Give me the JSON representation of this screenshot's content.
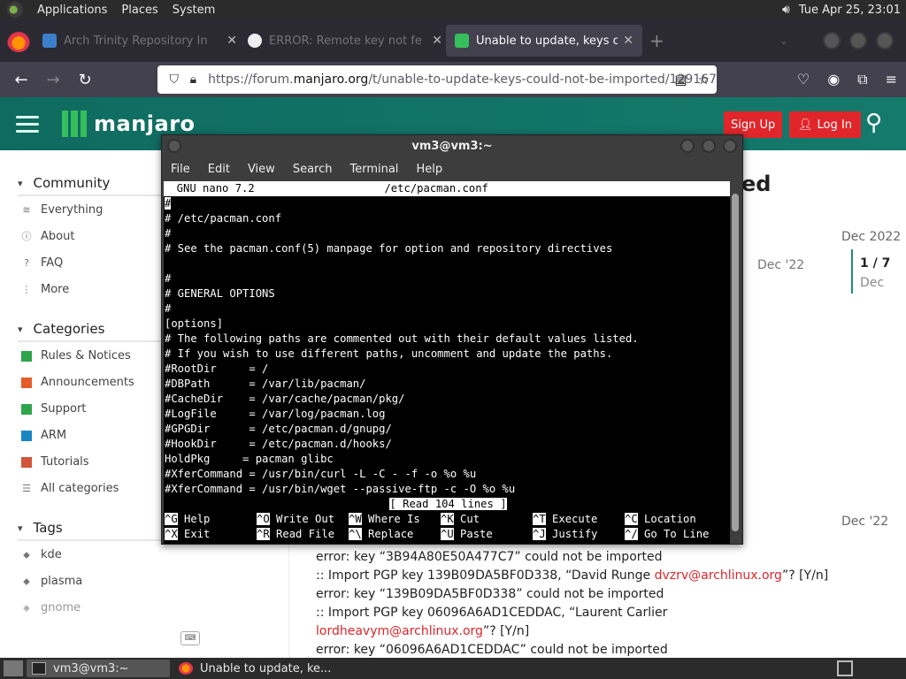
{
  "system_panel": {
    "menus": [
      "Applications",
      "Places",
      "System"
    ],
    "clock": "Tue Apr 25, 23:01"
  },
  "tabs": [
    {
      "title": "Arch Trinity Repository In",
      "active": false
    },
    {
      "title": "ERROR: Remote key not fe",
      "active": false
    },
    {
      "title": "Unable to update, keys could",
      "active": true
    }
  ],
  "urlbar": {
    "prefix": "https://forum.",
    "domain": "manjaro.org",
    "path": "/t/unable-to-update-keys-could-not-be-imported/129167"
  },
  "site": {
    "logo": "manjaro",
    "signup": "Sign Up",
    "login": "Log In",
    "title_fragment": "ed"
  },
  "sidebar": {
    "community": {
      "heading": "Community",
      "items": [
        "Everything",
        "About",
        "FAQ",
        "More"
      ]
    },
    "categories": {
      "heading": "Categories",
      "items": [
        {
          "label": "Rules & Notices",
          "color": "#2da54a"
        },
        {
          "label": "Announcements",
          "color": "#e45d28"
        },
        {
          "label": "Support",
          "color": "#2da54a"
        },
        {
          "label": "ARM",
          "color": "#1a86c1"
        },
        {
          "label": "Tutorials",
          "color": "#d2543b"
        },
        {
          "label": "All categories",
          "color": ""
        }
      ]
    },
    "tags": {
      "heading": "Tags",
      "items": [
        "kde",
        "plasma",
        "gnome"
      ]
    }
  },
  "timeline": {
    "date_top": "Dec 2022",
    "post_date": "Dec '22",
    "progress": "1 / 7",
    "progress_sub": "Dec",
    "post_date_2": "Dec '22"
  },
  "post_lines": {
    "l1": "error: key “3B94A80E50A477C7” could not be imported",
    "l2_a": ":: Import PGP key 139B09DA5BF0D338, “David Runge ",
    "l2_mail": "dvzrv@archlinux.org",
    "l2_b": "”? [Y/n]",
    "l3": "error: key “139B09DA5BF0D338” could not be imported",
    "l4": ":: Import PGP key 06096A6AD1CEDDAC, “Laurent Carlier",
    "l5_mail": "lordheavym@archlinux.org",
    "l5_b": "”? [Y/n]",
    "l6": "error: key “06096A6AD1CEDDAC” could not be imported"
  },
  "terminal": {
    "title": "vm3@vm3:~",
    "menu": [
      "File",
      "Edit",
      "View",
      "Search",
      "Terminal",
      "Help"
    ],
    "nano_header": "  GNU nano 7.2                    /etc/pacman.conf",
    "lines": [
      "#",
      "# /etc/pacman.conf",
      "#",
      "# See the pacman.conf(5) manpage for option and repository directives",
      "",
      "#",
      "# GENERAL OPTIONS",
      "#",
      "[options]",
      "# The following paths are commented out with their default values listed.",
      "# If you wish to use different paths, uncomment and update the paths.",
      "#RootDir     = /",
      "#DBPath      = /var/lib/pacman/",
      "#CacheDir    = /var/cache/pacman/pkg/",
      "#LogFile     = /var/log/pacman.log",
      "#GPGDir      = /etc/pacman.d/gnupg/",
      "#HookDir     = /etc/pacman.d/hooks/",
      "HoldPkg     = pacman glibc",
      "#XferCommand = /usr/bin/curl -L -C - -f -o %o %u",
      "#XferCommand = /usr/bin/wget --passive-ftp -c -O %o %u"
    ],
    "status": "[ Read 104 lines ]",
    "shortcuts_row1": [
      [
        "^G",
        "Help"
      ],
      [
        "^O",
        "Write Out"
      ],
      [
        "^W",
        "Where Is"
      ],
      [
        "^K",
        "Cut"
      ],
      [
        "^T",
        "Execute"
      ],
      [
        "^C",
        "Location"
      ]
    ],
    "shortcuts_row2": [
      [
        "^X",
        "Exit"
      ],
      [
        "^R",
        "Read File"
      ],
      [
        "^\\",
        "Replace"
      ],
      [
        "^U",
        "Paste"
      ],
      [
        "^J",
        "Justify"
      ],
      [
        "^/",
        "Go To Line"
      ]
    ]
  },
  "taskbar": {
    "items": [
      "vm3@vm3:~",
      "Unable to update, ke..."
    ]
  }
}
